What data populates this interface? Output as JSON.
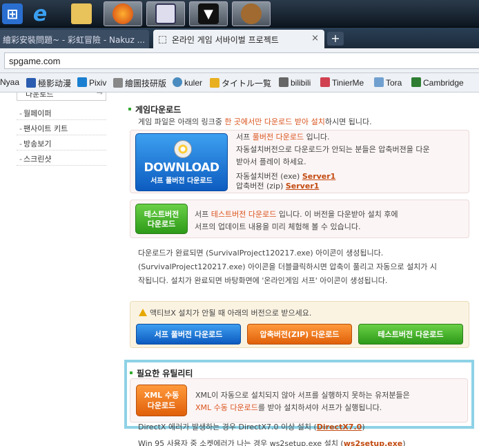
{
  "taskbar": {
    "buttons": [
      {
        "icon": "windows-icon"
      },
      {
        "icon": "ie-icon"
      },
      {
        "icon": "folder-icon"
      },
      {
        "icon": "firefox-icon"
      },
      {
        "icon": "window-icon"
      },
      {
        "icon": "foobar-icon"
      },
      {
        "icon": "bear-icon"
      }
    ]
  },
  "tabs": [
    {
      "label": "繪彩安裝問題~ - 彩虹冒險 - Nakuz ..."
    },
    {
      "label": "온라인 게임 서바이벌 프로젝트"
    }
  ],
  "tab_close": "×",
  "newtab": "+",
  "address": "spgame.com",
  "bookmarks": [
    {
      "label": "Nyaa",
      "color": "#3c8ed0"
    },
    {
      "label": "極影动漫",
      "color": "#2a5db0"
    },
    {
      "label": "Pixiv",
      "color": "#1a7fd0"
    },
    {
      "label": "繪圖技研版",
      "color": "#888888"
    },
    {
      "label": "kuler",
      "color": "#4a8cc0"
    },
    {
      "label": "タイトル一覧",
      "color": "#e8b020"
    },
    {
      "label": "bilibili",
      "color": "#666666"
    },
    {
      "label": "TinierMe",
      "color": "#d04050"
    },
    {
      "label": "Tora",
      "color": "#70a0d0"
    },
    {
      "label": "Cambridge",
      "color": "#2e7d32"
    }
  ],
  "sidebar": {
    "top": "다운로드",
    "items": [
      "월페이퍼",
      "팬사이트 키트",
      "방송보기",
      "스크린샷"
    ]
  },
  "download": {
    "title": "게임다운로드",
    "intro_pre": "게임 파일은 아래의 링크중 ",
    "intro_hl": "한 곳에서만 다운로드 받아 설치",
    "intro_post": "하시면 됩니다.",
    "dl_big": "DOWNLOAD",
    "dl_small": "서프 풀버전 다운로드",
    "full_pre": "서프 ",
    "full_hl": "풀버전 다운로드",
    "full_post": " 입니다.",
    "full_desc1": "자동설치버전으로 다운로드가 안되는 분들은 압축버젼을 다운",
    "full_desc2": "받아서 플레이 하세요.",
    "exe_label": "자동설치버전 (exe) ",
    "exe_link": "Server1",
    "zip_label": "압축버전 (zip) ",
    "zip_link": "Server1",
    "test_btn1": "테스트버전",
    "test_btn2": "다운로드",
    "test_pre": "서프 ",
    "test_hl": "테스트버전 다운로드",
    "test_post": " 입니다. 이 버전을 다운받아 설치 후에",
    "test_desc": "서프의 업데이트 내용을 미리 체험해 볼 수 있습니다.",
    "done1": "다운로드가 완료되면 (SurvivalProject120217.exe) 아이콘이 생성됩니다.",
    "done2": "(SurvivalProject120217.exe) 아이콘을 더블클릭하시면 압축이 풀리고 자동으로 설치가 시",
    "done3": "작됩니다. 설치가 완료되면 바탕화면에 '온라인게임 서프' 아이콘이 생성됩니다."
  },
  "activex": {
    "warn": "액티브X 설치가 안될 때 아래의 버전으로 받으세요.",
    "btn_full": "서프 풀버전 다운로드",
    "btn_zip": "압축버전(ZIP) 다운로드",
    "btn_test": "테스트버전 다운로드"
  },
  "utility": {
    "title": "필요한 유틸리티",
    "btn1": "XML 수동",
    "btn2": "다운로드",
    "desc1": "XML이 자동으로 설치되지 않아 서프를 실행하지 못하는 유저분들은",
    "desc2_hl": "XML 수동 다운로드",
    "desc2_post": "를 받아 설치하셔야 서프가 실행됩니다.",
    "cut1_pre": "DirectX 에러가 발생하는 경우 DirectX7.0 이상 설치 (",
    "cut1_link": "DirectX7.0",
    "cut1_post": ")",
    "cut2_pre": "Win 95 사용자 중 소켓에러가 나는 경우 ws2setup.exe 설치 (",
    "cut2_link": "ws2setup.exe",
    "cut2_post": ")"
  }
}
